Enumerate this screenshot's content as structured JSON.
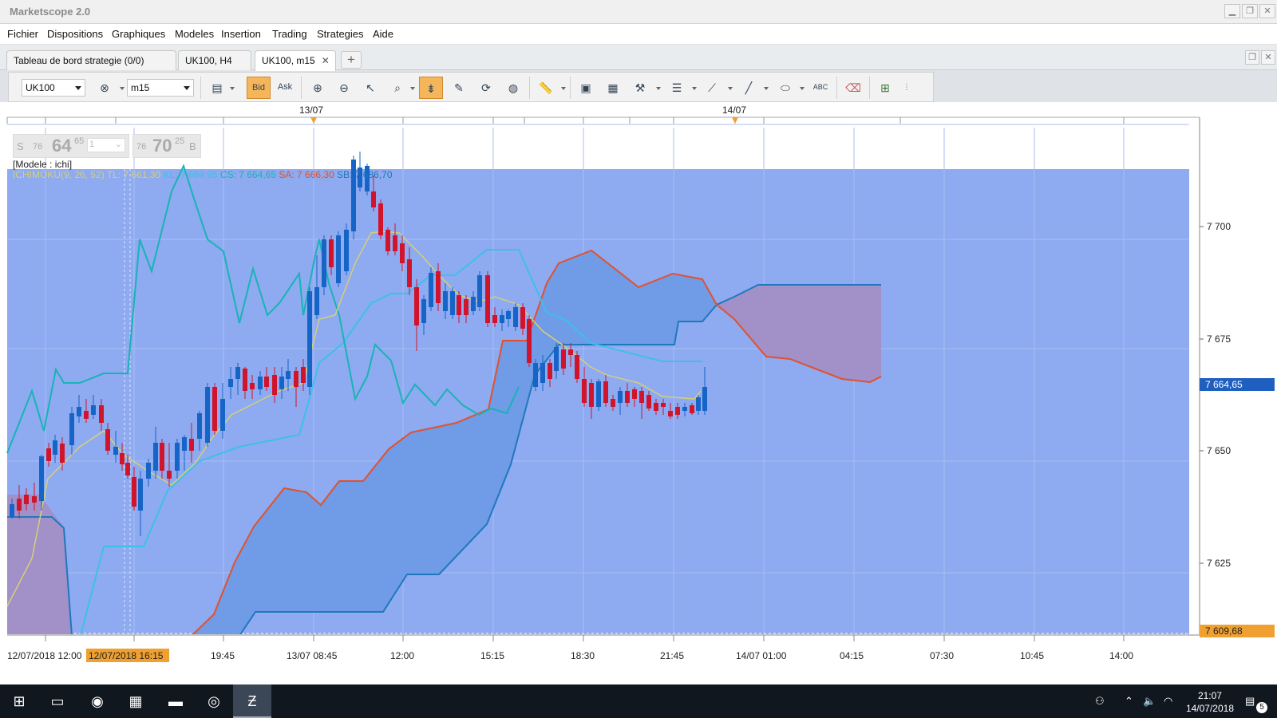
{
  "window": {
    "title": "Marketscope 2.0",
    "buttons": [
      "▁",
      "❐",
      "✕"
    ]
  },
  "menu": [
    "Fichier",
    "Dispositions",
    "Graphiques",
    "Modeles",
    "Insertion",
    "Trading",
    "Strategies",
    "Aide"
  ],
  "tabs": [
    {
      "label": "Tableau de bord strategie (0/0)"
    },
    {
      "label": "UK100, H4"
    },
    {
      "label": "UK100, m15",
      "close": "✕"
    }
  ],
  "add_tab": "+",
  "toolbar": {
    "instrument": "UK100",
    "timeframe": "m15",
    "bid": "Bid",
    "ask": "Ask",
    "abc": "ABC"
  },
  "price_box": {
    "sell_letter": "S",
    "sell_small": "76",
    "sell_big": "64",
    "sell_sup": "65",
    "lot": "1",
    "buy_small": "76",
    "buy_big": "70",
    "buy_sup": "25",
    "buy_letter": "B"
  },
  "model_label": "[Modele : ichi]",
  "legend": {
    "ichi": "ICHIMOKU(9, 26, 52)",
    "tl": "TL: 7 661,30",
    "kl": "KL: 7 669,95",
    "cs": "CS: 7 664,65",
    "sa": "SA: 7 666,30",
    "sb": "SB: 7 686,70"
  },
  "top_dates": [
    "13/07",
    "14/07"
  ],
  "price_labels": [
    "7 700",
    "7 675",
    "7 650",
    "7 625"
  ],
  "current_price": "7 664,65",
  "bottom_price": "7 609,68",
  "time_labels": [
    "12/07/2018 12:00",
    "19:45",
    "13/07 08:45",
    "12:00",
    "15:15",
    "18:30",
    "21:45",
    "14/07 01:00",
    "04:15",
    "07:30",
    "10:45",
    "14:00"
  ],
  "cursor_time": "12/07/2018 16:15",
  "colors": {
    "background": "#8eaaf0",
    "tenkan": "#d6cf78",
    "kijun": "#3cc0ea",
    "chikou": "#18b3b6",
    "senkou_a": "#e1512c",
    "senkou_b": "#1f78bd",
    "cloud_bull": "#6c99e6",
    "cloud_bear": "#a38ec6",
    "candle_up": "#1664c6",
    "candle_down": "#d1142b"
  },
  "taskbar": {
    "apps": [
      "start-icon",
      "task-view-icon",
      "app-icon",
      "calculator-icon",
      "folder-icon",
      "chrome-icon",
      "marketscope-icon"
    ],
    "clock_time": "21:07",
    "clock_date": "14/07/2018",
    "notifications": "5"
  }
}
